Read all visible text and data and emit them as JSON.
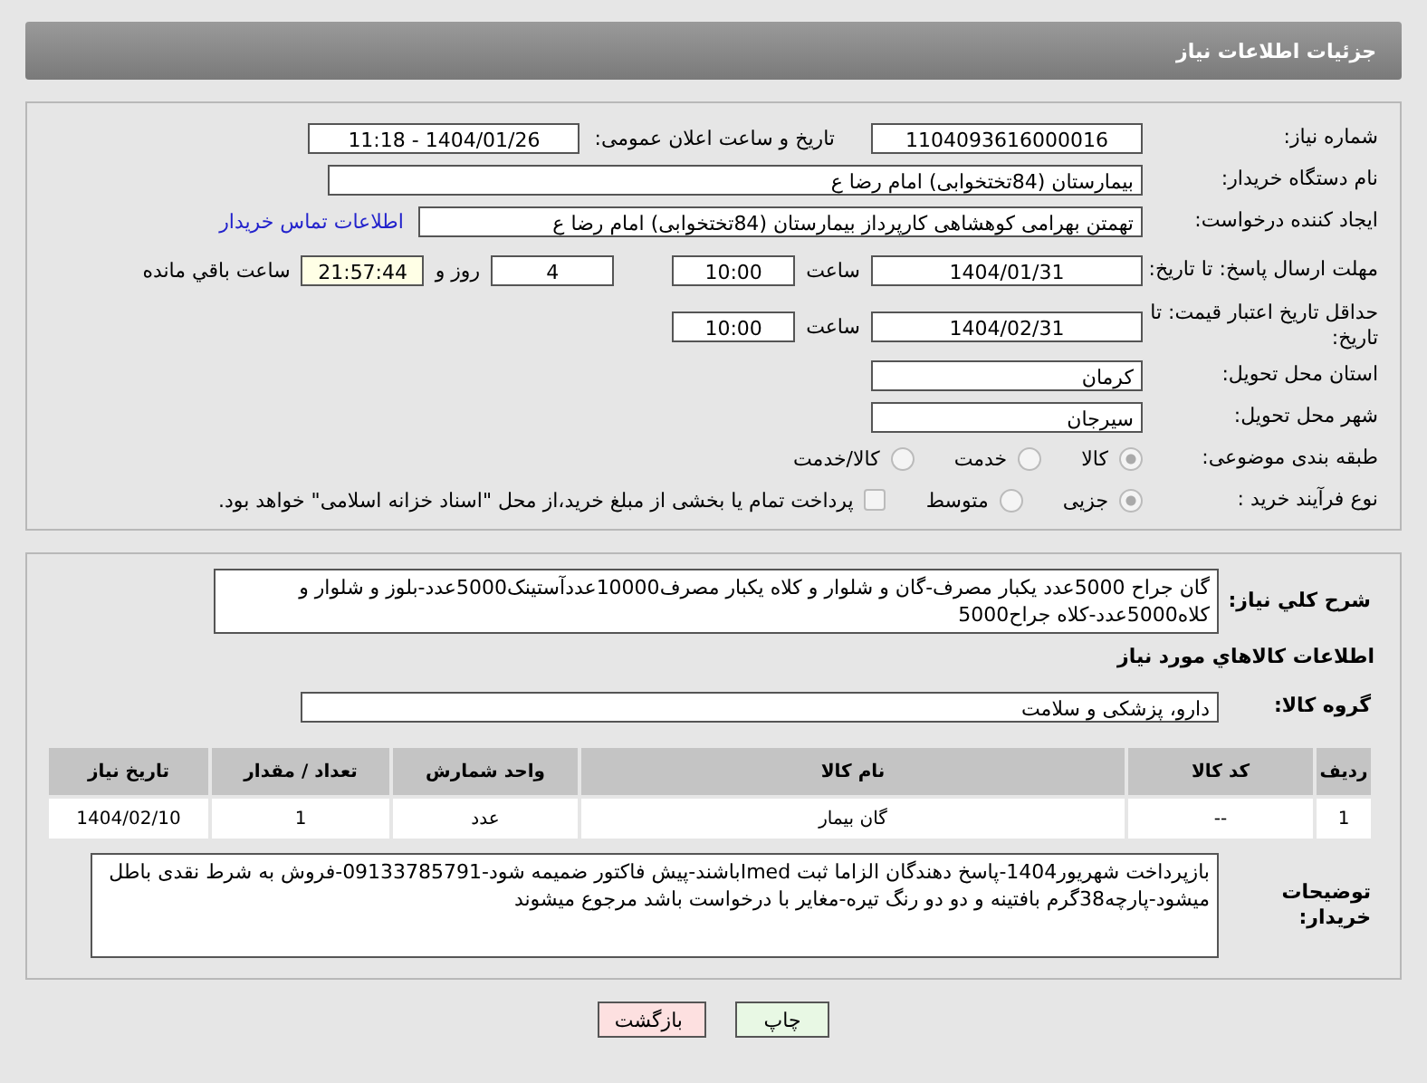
{
  "header": {
    "title": "جزئیات اطلاعات نیاز"
  },
  "need_number": {
    "label": "شماره نیاز:",
    "value": "1104093616000016"
  },
  "announce": {
    "label": "تاریخ و ساعت اعلان عمومی:",
    "value": "1404/01/26 - 11:18"
  },
  "buyer_org": {
    "label": "نام دستگاه خریدار:",
    "value": "بیمارستان (84تختخوابی) امام رضا  ع"
  },
  "creator": {
    "label": "ایجاد کننده درخواست:",
    "value": "تهمتن بهرامی کوهشاهی کارپرداز بیمارستان (84تختخوابی) امام رضا  ع",
    "link": "اطلاعات تماس خریدار"
  },
  "reply_deadline": {
    "label": "مهلت ارسال پاسخ: تا تاریخ:",
    "date": "1404/01/31",
    "time_label": "ساعت",
    "time": "10:00",
    "days": "4",
    "days_label": "روز و",
    "remaining": "21:57:44",
    "remaining_label": "ساعت باقي مانده"
  },
  "price_validity": {
    "label": "حداقل تاریخ اعتبار قیمت: تا تاریخ:",
    "date": "1404/02/31",
    "time_label": "ساعت",
    "time": "10:00"
  },
  "province": {
    "label": "استان محل تحویل:",
    "value": "کرمان"
  },
  "city": {
    "label": "شهر محل تحویل:",
    "value": "سیرجان"
  },
  "category": {
    "label": "طبقه بندی موضوعی:",
    "options": [
      {
        "label": "کالا",
        "selected": true
      },
      {
        "label": "خدمت",
        "selected": false
      },
      {
        "label": "کالا/خدمت",
        "selected": false
      }
    ]
  },
  "process": {
    "label": "نوع فرآیند خرید :",
    "options": [
      {
        "label": "جزیی",
        "selected": true
      },
      {
        "label": "متوسط",
        "selected": false
      }
    ],
    "treasury": {
      "label": "پرداخت تمام یا بخشی از مبلغ خرید،از محل \"اسناد خزانه اسلامی\" خواهد بود.",
      "checked": false
    }
  },
  "description": {
    "label": "شرح کلي نیاز:",
    "value": "گان جراح 5000عدد یکبار مصرف-گان و شلوار و کلاه یکبار مصرف10000عددآستینک5000عدد-بلوز و شلوار و کلاه5000عدد-کلاه جراح5000"
  },
  "goods_heading": "اطلاعات کالاهاي مورد نیاز",
  "goods_group": {
    "label": "گروه کالا:",
    "value": "دارو، پزشکی و سلامت"
  },
  "table": {
    "columns": [
      "ردیف",
      "کد کالا",
      "نام کالا",
      "واحد شمارش",
      "تعداد / مقدار",
      "تاریخ نیاز"
    ],
    "rows": [
      [
        "1",
        "--",
        "گان بیمار",
        "عدد",
        "1",
        "1404/02/10"
      ]
    ]
  },
  "buyer_notes": {
    "label": "توضیحات خریدار:",
    "value": "بازپرداخت شهریور1404-پاسخ دهندگان الزاما ثبت Imedباشند-پیش فاکتور ضمیمه شود-09133785791-فروش به شرط نقدی باطل میشود-پارچه38گرم بافتینه و دو دو رنگ تیره-مغایر با درخواست باشد مرجوع میشوند"
  },
  "buttons": [
    {
      "label": "چاپ",
      "kind": "print"
    },
    {
      "label": "بازگشت",
      "kind": "back"
    }
  ]
}
